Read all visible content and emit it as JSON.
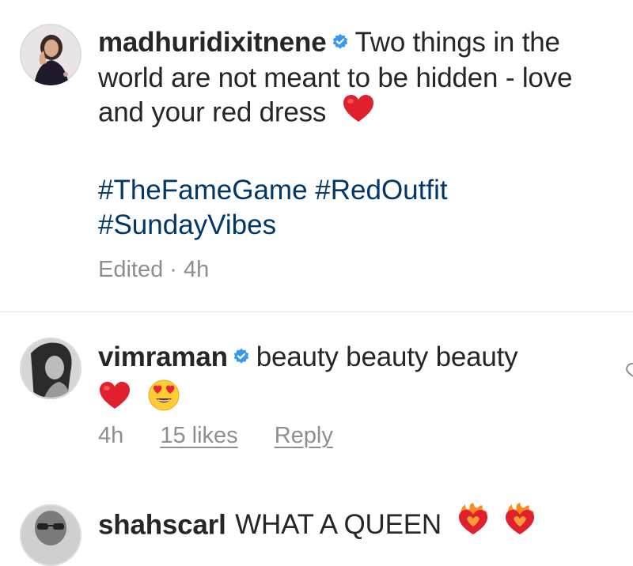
{
  "caption": {
    "username": "madhuridixitnene",
    "text_line1": "Two things in the",
    "text_line2": "world are not meant to be hidden - love",
    "text_line3": "and your red dress",
    "hashtags_line1": "#TheFameGame #RedOutfit",
    "hashtags_line2": "#SundayVibes",
    "meta": "Edited · 4h",
    "icons": [
      "verified-badge-icon",
      "red-heart-emoji"
    ]
  },
  "comments": [
    {
      "username": "vimraman",
      "text": "beauty beauty beauty",
      "time": "4h",
      "likes": "15 likes",
      "reply": "Reply",
      "icons": [
        "verified-badge-icon",
        "red-heart-emoji",
        "heart-eyes-emoji",
        "like-heart-icon"
      ]
    },
    {
      "username": "shahscarl",
      "text": "WHAT A QUEEN",
      "icons": [
        "heart-on-fire-emoji"
      ]
    }
  ],
  "colors": {
    "text": "#262626",
    "hashtag": "#00376b",
    "meta": "#8e8e8e",
    "verified": "#3897f0",
    "divider": "#e6e6e6"
  }
}
